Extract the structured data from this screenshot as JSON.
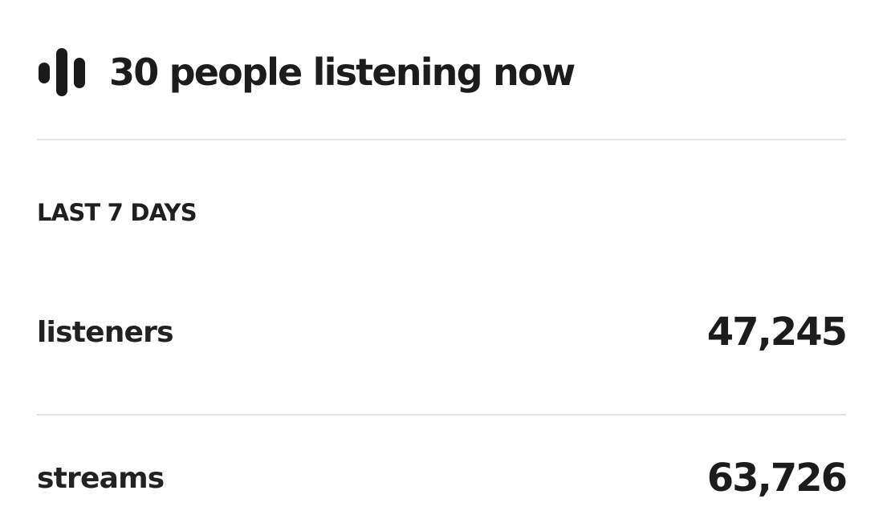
{
  "live": {
    "icon": "audio-bars-icon",
    "text": "30 people listening now"
  },
  "period": {
    "label": "LAST 7 DAYS"
  },
  "stats": {
    "listeners": {
      "label": "listeners",
      "value": "47,245"
    },
    "streams": {
      "label": "streams",
      "value": "63,726"
    }
  },
  "colors": {
    "text": "#1f1f1f",
    "divider": "#e3e3e3",
    "background": "#ffffff"
  }
}
